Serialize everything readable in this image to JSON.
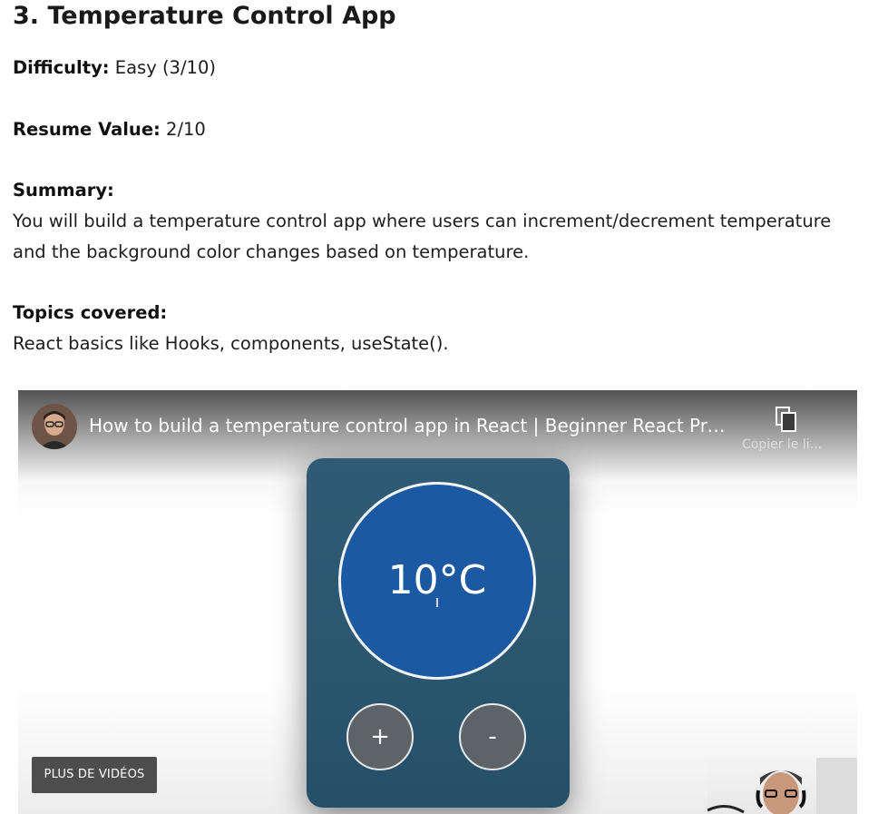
{
  "article": {
    "heading": "3. Temperature Control App",
    "difficulty_label": "Difficulty:",
    "difficulty_value": "Easy (3/10)",
    "resume_label": "Resume Value:",
    "resume_value": "2/10",
    "summary_label": "Summary:",
    "summary_text": "You will build a temperature control app where users can increment/decrement temperature and the background color changes based on temperature.",
    "topics_label": "Topics covered:",
    "topics_text": "React basics like Hooks, components, useState()."
  },
  "video": {
    "title": "How to build a temperature control app in React | Beginner React Proj...",
    "copy_link_label": "Copier le li...",
    "more_videos_label": "PLUS DE VIDÉOS",
    "preview": {
      "temperature": "10°C",
      "increment_label": "+",
      "decrement_label": "-",
      "circle_color": "#1b5aa3",
      "card_color": "#2f5b76"
    }
  }
}
